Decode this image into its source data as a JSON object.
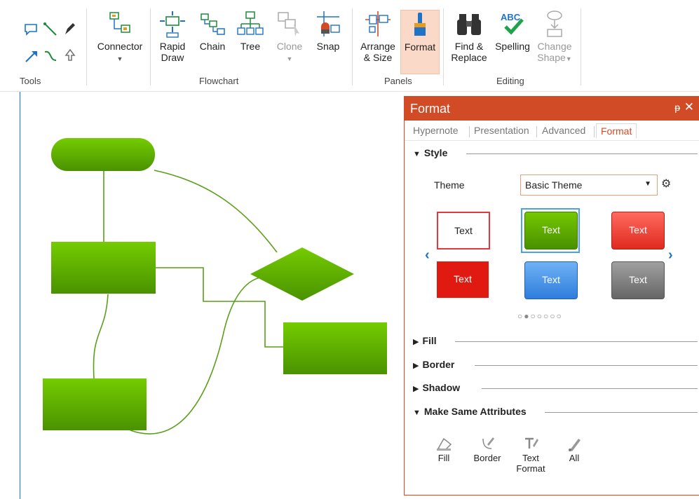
{
  "ribbon": {
    "groups": {
      "tools": "Tools",
      "flowchart": "Flowchart",
      "panels": "Panels",
      "editing": "Editing"
    },
    "buttons": {
      "connector": "Connector",
      "rapid_draw_1": "Rapid",
      "rapid_draw_2": "Draw",
      "chain": "Chain",
      "tree": "Tree",
      "clone": "Clone",
      "snap": "Snap",
      "arrange_1": "Arrange",
      "arrange_2": "& Size",
      "format": "Format",
      "find_1": "Find &",
      "find_2": "Replace",
      "spelling": "Spelling",
      "change_1": "Change",
      "change_2": "Shape"
    },
    "spelling_icon_text": "ABC"
  },
  "panel": {
    "title": "Format",
    "pin": "ᵽ",
    "close": "✕",
    "tabs": [
      "Hypernote",
      "Presentation",
      "Advanced",
      "Format"
    ],
    "sections": {
      "style": "Style",
      "fill": "Fill",
      "border": "Border",
      "shadow": "Shadow",
      "make_same": "Make Same Attributes"
    },
    "theme_label": "Theme",
    "theme_value": "Basic Theme",
    "style_samples": [
      "Text",
      "Text",
      "Text",
      "Text",
      "Text",
      "Text"
    ],
    "pager": "○●○○○○○",
    "make_same_items": [
      {
        "label_1": "Fill",
        "label_2": ""
      },
      {
        "label_1": "Border",
        "label_2": ""
      },
      {
        "label_1": "Text",
        "label_2": "Format"
      },
      {
        "label_1": "All",
        "label_2": ""
      }
    ]
  },
  "colors": {
    "accent": "#d24b27",
    "shape_green_top": "#72c900",
    "shape_green_bottom": "#4a9400",
    "link_blue": "#1e73c8"
  }
}
